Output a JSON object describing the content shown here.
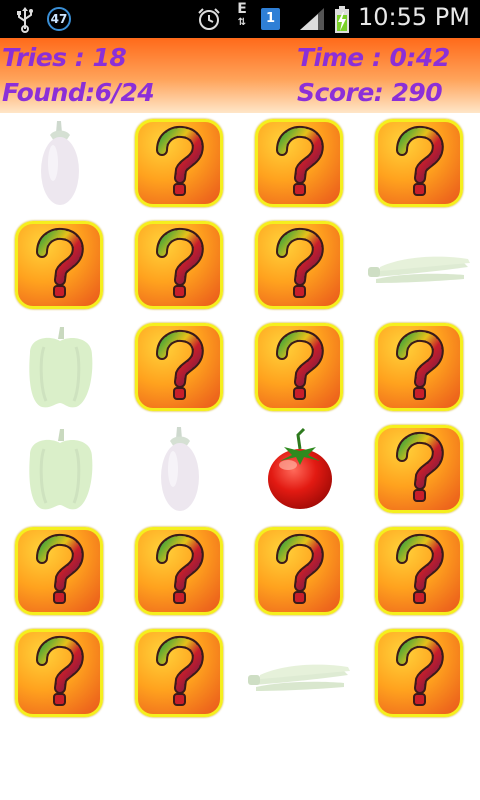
{
  "status_bar": {
    "notification_count": "47",
    "sim_slot": "1",
    "network_letter": "E",
    "time": "10:55 PM"
  },
  "header": {
    "tries": "Tries : 18",
    "found": "Found:6/24",
    "time": "Time  : 0:42",
    "score": "Score: 290",
    "text_color": "#8b2fd8",
    "gradient_top": "#ff6a1a",
    "gradient_bottom": "#ffe6c8"
  },
  "board": {
    "columns": 4,
    "rows": 6,
    "card_back_icon": "question-mark-icon",
    "cards": [
      {
        "state": "matched",
        "item": "eggplant"
      },
      {
        "state": "hidden",
        "item": null
      },
      {
        "state": "hidden",
        "item": null
      },
      {
        "state": "hidden",
        "item": null
      },
      {
        "state": "hidden",
        "item": null
      },
      {
        "state": "hidden",
        "item": null
      },
      {
        "state": "hidden",
        "item": null
      },
      {
        "state": "matched",
        "item": "okra"
      },
      {
        "state": "matched",
        "item": "bell-pepper"
      },
      {
        "state": "hidden",
        "item": null
      },
      {
        "state": "hidden",
        "item": null
      },
      {
        "state": "hidden",
        "item": null
      },
      {
        "state": "matched",
        "item": "bell-pepper"
      },
      {
        "state": "matched",
        "item": "eggplant"
      },
      {
        "state": "revealed",
        "item": "tomato"
      },
      {
        "state": "hidden",
        "item": null
      },
      {
        "state": "hidden",
        "item": null
      },
      {
        "state": "hidden",
        "item": null
      },
      {
        "state": "hidden",
        "item": null
      },
      {
        "state": "hidden",
        "item": null
      },
      {
        "state": "hidden",
        "item": null
      },
      {
        "state": "hidden",
        "item": null
      },
      {
        "state": "matched",
        "item": "okra"
      },
      {
        "state": "hidden",
        "item": null
      }
    ]
  }
}
